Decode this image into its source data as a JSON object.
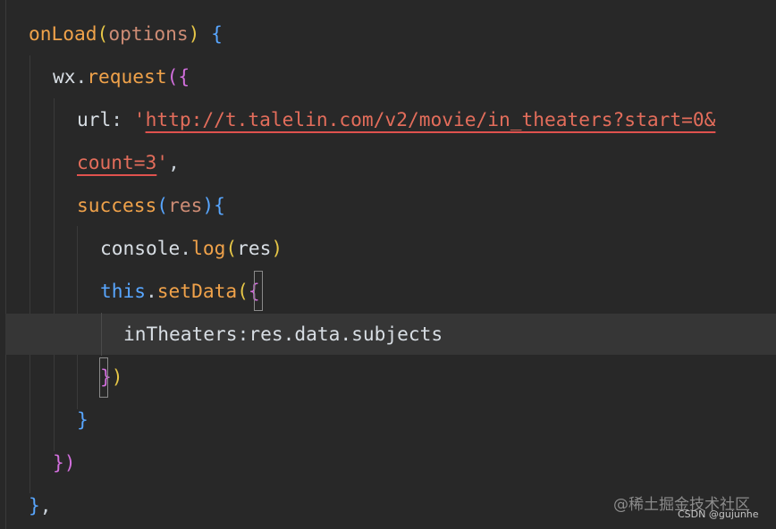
{
  "code": {
    "line1": {
      "fn": "onLoad",
      "open": "(",
      "param": "options",
      "close": ")",
      "brace": "{"
    },
    "line2": {
      "obj": "wx",
      "dot": ".",
      "fn": "request",
      "open": "(",
      "brace": "{"
    },
    "line3": {
      "key": "url",
      "colon": ": ",
      "quote": "'",
      "url": "http://t.talelin.com/v2/movie/in_theaters?start=0&"
    },
    "line4": {
      "url": "count=3",
      "quote": "'",
      "comma": ","
    },
    "line5": {
      "fn": "success",
      "open": "(",
      "param": "res",
      "close": ")",
      "brace": "{"
    },
    "line6": {
      "obj": "console",
      "dot": ".",
      "fn": "log",
      "open": "(",
      "arg": "res",
      "close": ")"
    },
    "line7": {
      "this": "this",
      "dot": ".",
      "fn": "setData",
      "open": "(",
      "brace": "{"
    },
    "line8": {
      "key": "inTheaters",
      "colon": ":",
      "value": "res.data.subjects"
    },
    "line9": {
      "brace": "}",
      "close": ")"
    },
    "line10": {
      "brace": "}"
    },
    "line11": {
      "brace": "}",
      "close": ")"
    },
    "line12": {
      "brace": "}",
      "comma": ","
    }
  },
  "watermark": {
    "site": "@稀土掘金技术社区",
    "author": "CSDN @gujunhe"
  },
  "colors": {
    "background": "#282828",
    "function": "#f0a24a",
    "string": "#e36d5b",
    "brace_level1": "#58a6ff",
    "brace_level2": "#d26fdd",
    "brace_level3": "#e6c647"
  }
}
